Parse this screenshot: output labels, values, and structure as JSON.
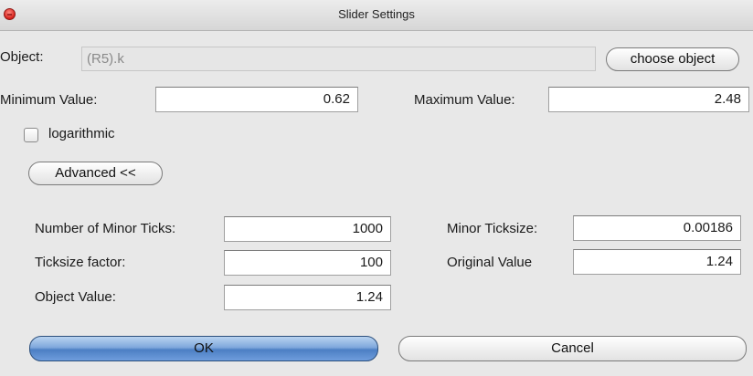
{
  "window": {
    "title": "Slider Settings"
  },
  "object": {
    "label": "Object:",
    "value": "(R5).k",
    "choose_button": "choose object"
  },
  "range": {
    "min_label": "Minimum Value:",
    "min_value": "0.62",
    "max_label": "Maximum Value:",
    "max_value": "2.48",
    "log_label": "logarithmic",
    "log_checked": false
  },
  "advanced_button": "Advanced <<",
  "advanced": {
    "minor_ticks_label": "Number of Minor Ticks:",
    "minor_ticks_value": "1000",
    "ticksize_factor_label": "Ticksize factor:",
    "ticksize_factor_value": "100",
    "object_value_label": "Object Value:",
    "object_value_value": "1.24",
    "minor_ticksize_label": "Minor Ticksize:",
    "minor_ticksize_value": "0.00186",
    "original_value_label": "Original Value",
    "original_value_value": "1.24"
  },
  "buttons": {
    "ok": "OK",
    "cancel": "Cancel"
  }
}
